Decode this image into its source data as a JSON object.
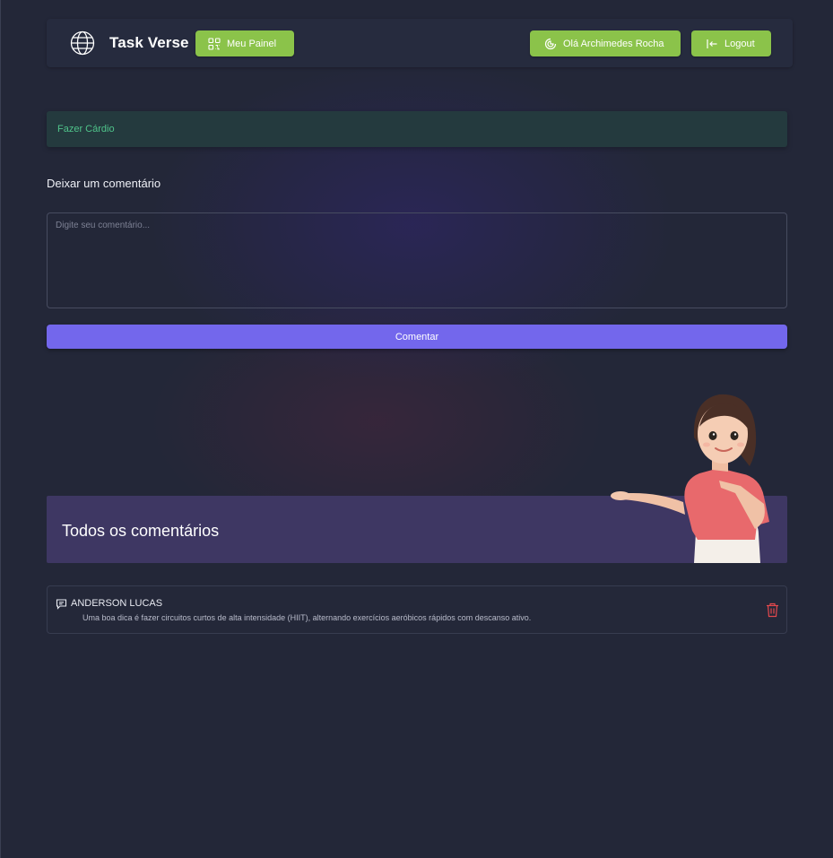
{
  "header": {
    "brand": "Task Verse",
    "panel_button": "Meu Painel",
    "user_button": "Olá Archimedes Rocha",
    "logout_button": "Logout"
  },
  "task": {
    "title": "Fazer Cárdio"
  },
  "comment_form": {
    "heading": "Deixar um comentário",
    "placeholder": "Digite seu comentário...",
    "submit_label": "Comentar"
  },
  "comments_section": {
    "heading": "Todos os comentários",
    "items": [
      {
        "author": "ANDERSON LUCAS",
        "text": "Uma boa dica é fazer circuitos curtos de alta intensidade (HIIT), alternando exercícios aeróbicos rápidos com descanso ativo."
      }
    ]
  },
  "colors": {
    "background": "#232738",
    "header": "#262b3e",
    "green_button": "#8bc34a",
    "task_text": "#4fc38a",
    "primary_button": "#7367ec",
    "comments_banner": "#3e3763",
    "delete_icon": "#e5484d"
  },
  "icons": {
    "brand": "globe-icon",
    "panel": "qr-grid-icon",
    "user": "user-circle-icon",
    "logout": "logout-arrow-icon",
    "comment": "message-icon",
    "delete": "trash-icon"
  }
}
